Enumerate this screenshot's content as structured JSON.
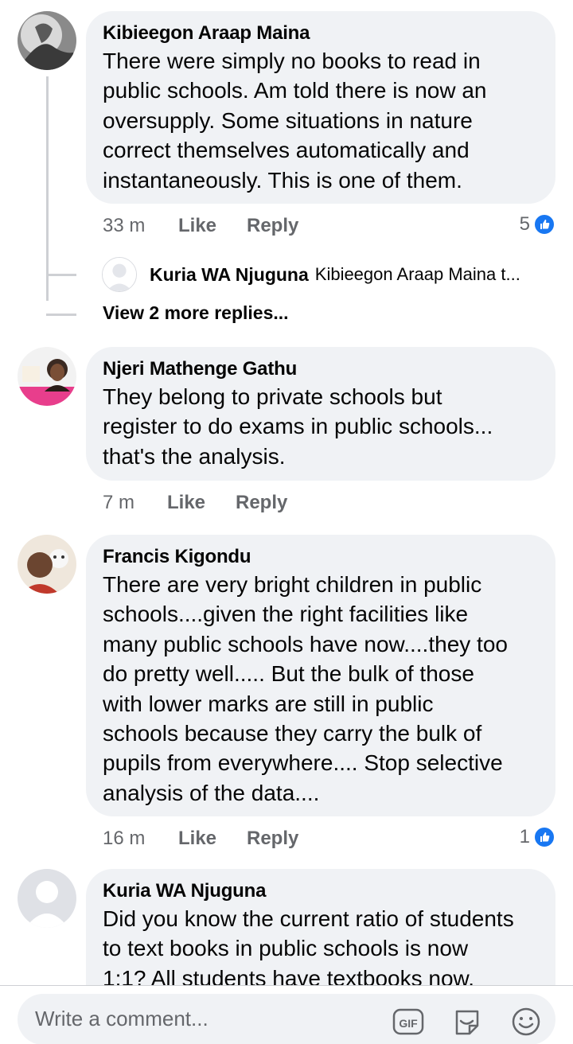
{
  "comments": [
    {
      "author": "Kibieegon Araap Maina",
      "lines": [
        "There were simply no books to read in",
        "public schools. Am told there is now an",
        "oversupply. Some situations in nature",
        "correct themselves automatically and",
        "instantaneously. This is one of them."
      ],
      "time": "33 m",
      "like": "Like",
      "reply": "Reply",
      "reaction_count": "5",
      "reply_preview": {
        "author": "Kuria WA Njuguna",
        "text": "Kibieegon Araap Maina t..."
      },
      "view_more": "View 2 more replies..."
    },
    {
      "author": "Njeri Mathenge Gathu",
      "lines": [
        "They belong to private schools but",
        "register to do exams in public schools...",
        "that's the analysis."
      ],
      "time": "7 m",
      "like": "Like",
      "reply": "Reply"
    },
    {
      "author": "Francis Kigondu",
      "lines": [
        "There are very bright children in public",
        "schools....given the right facilities like",
        "many public schools have now....they too",
        "do pretty well..... But the bulk of those",
        "with lower marks are still in public",
        "schools because they carry the bulk of",
        "pupils from everywhere.... Stop selective",
        "analysis of the data...."
      ],
      "time": "16 m",
      "like": "Like",
      "reply": "Reply",
      "reaction_count": "1"
    },
    {
      "author": "Kuria WA Njuguna",
      "lines": [
        "Did you know the current ratio of students",
        "to text books in public schools is now",
        "1:1? All students have textbooks now."
      ]
    }
  ],
  "composer": {
    "placeholder": "Write a comment...",
    "gif_label": "GIF"
  },
  "icons": {
    "like_badge": "thumbs-up-icon",
    "gif": "gif-icon",
    "sticker": "sticker-icon",
    "emoji": "emoji-icon"
  },
  "colors": {
    "bubble": "#f0f2f5",
    "accent": "#1877f2",
    "secondary_text": "#65676b"
  }
}
